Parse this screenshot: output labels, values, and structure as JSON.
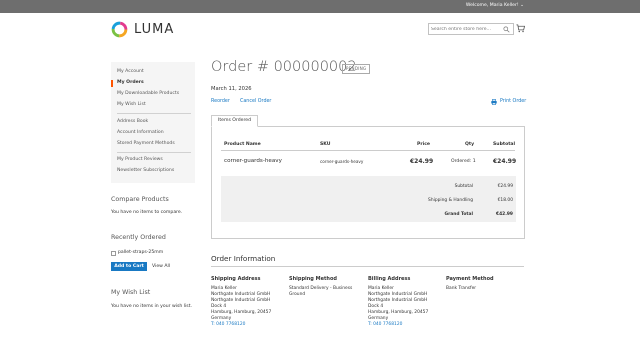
{
  "header": {
    "welcome": "Welcome, Maria Keller!",
    "logo_text": "LUMA",
    "search_placeholder": "Search entire store here..."
  },
  "sidebar": {
    "items": [
      {
        "label": "My Account",
        "active": false
      },
      {
        "label": "My Orders",
        "active": true
      },
      {
        "label": "My Downloadable Products",
        "active": false
      },
      {
        "label": "My Wish List",
        "active": false
      },
      {
        "label": "Address Book",
        "active": false
      },
      {
        "label": "Account Information",
        "active": false
      },
      {
        "label": "Stored Payment Methods",
        "active": false
      },
      {
        "label": "My Product Reviews",
        "active": false
      },
      {
        "label": "Newsletter Subscriptions",
        "active": false
      }
    ],
    "compare": {
      "title": "Compare Products",
      "text": "You have no items to compare."
    },
    "recent": {
      "title": "Recently Ordered",
      "item": "pallet-straps-25mm",
      "add_to_cart": "Add to Cart",
      "view_all": "View All"
    },
    "wishlist": {
      "title": "My Wish List",
      "text": "You have no items in your wish list."
    }
  },
  "order": {
    "title": "Order # 000000002",
    "status": "PENDING",
    "date": "March 11, 2026",
    "reorder": "Reorder",
    "cancel": "Cancel Order",
    "print": "Print Order",
    "tab": "Items Ordered",
    "columns": [
      "Product Name",
      "SKU",
      "Price",
      "Qty",
      "Subtotal"
    ],
    "item": {
      "name": "corner-guards-heavy",
      "sku": "corner-guards-heavy",
      "price": "€24.99",
      "qty_label": "Ordered:",
      "qty": "1",
      "subtotal": "€24.99"
    },
    "totals": [
      {
        "label": "Subtotal",
        "value": "€24.99",
        "bold": false
      },
      {
        "label": "Shipping & Handling",
        "value": "€18.00",
        "bold": false
      },
      {
        "label": "Grand Total",
        "value": "€42.99",
        "bold": true
      }
    ]
  },
  "info": {
    "title": "Order Information",
    "shipping_address": {
      "title": "Shipping Address",
      "lines": [
        "Maria Keller",
        "Northgate Industrial GmbH",
        "Northgate Industrial GmbH",
        "Dock 4",
        "Hamburg, Hamburg, 20457",
        "Germany"
      ],
      "phone": "T: 040 7768120"
    },
    "shipping_method": {
      "title": "Shipping Method",
      "lines": [
        "Standard Delivery - Business",
        "Ground"
      ]
    },
    "billing_address": {
      "title": "Billing Address",
      "lines": [
        "Maria Keller",
        "Northgate Industrial GmbH",
        "Northgate Industrial GmbH",
        "Dock 4",
        "Hamburg, Hamburg, 20457",
        "Germany"
      ],
      "phone": "T: 040 7768120"
    },
    "payment_method": {
      "title": "Payment Method",
      "lines": [
        "Bank Transfer"
      ]
    }
  },
  "colors": {
    "accent": "#1979c3",
    "nav_active": "#ff5501",
    "topbar": "#6e6e6e"
  }
}
